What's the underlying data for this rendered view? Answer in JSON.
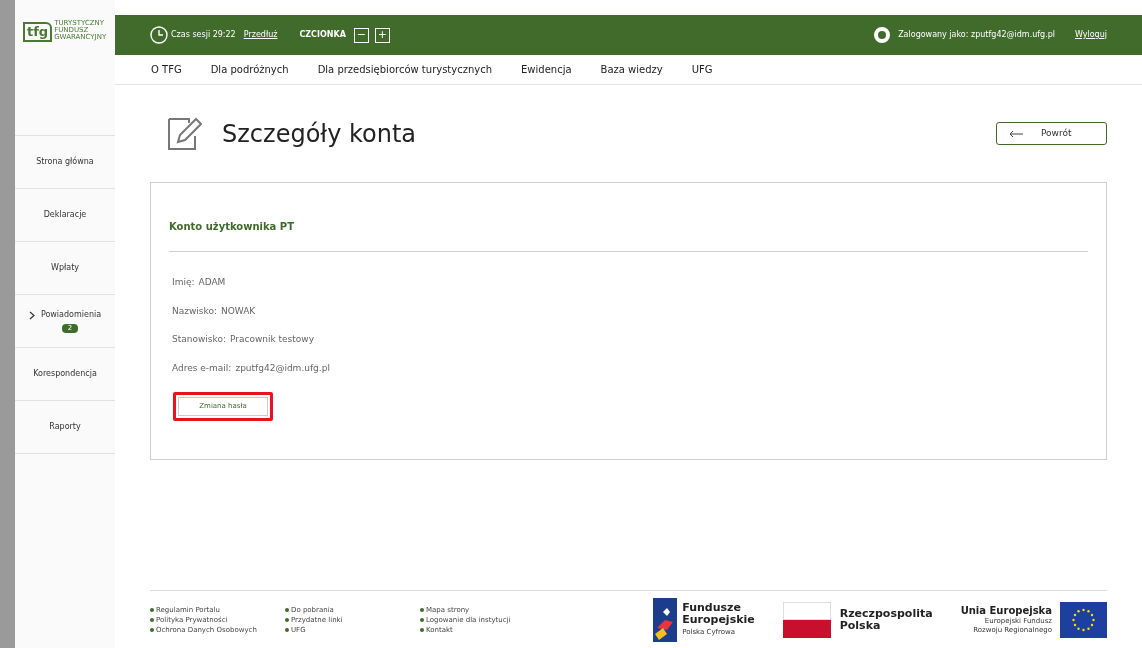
{
  "logo": {
    "mark": "tfg",
    "lines": [
      "TURYSTYCZNY",
      "FUNDUSZ",
      "GWARANCYJNY"
    ]
  },
  "header": {
    "session_label": "Czas sesji 29:22",
    "extend": "Przedłuż",
    "font_label": "CZCIONKA",
    "font_minus": "−",
    "font_plus": "+",
    "logged_as": "Zalogowany jako: zputfg42@idm.ufg.pl",
    "logout": "Wyloguj"
  },
  "nav": [
    "O TFG",
    "Dla podróżnych",
    "Dla przedsiębiorców turystycznych",
    "Ewidencja",
    "Baza wiedzy",
    "UFG"
  ],
  "sidebar": [
    {
      "label": "Strona główna",
      "expandable": false
    },
    {
      "label": "Deklaracje",
      "expandable": false
    },
    {
      "label": "Wpłaty",
      "expandable": false
    },
    {
      "label": "Powiadomienia",
      "expandable": true,
      "badge": "2"
    },
    {
      "label": "Korespondencja",
      "expandable": false
    },
    {
      "label": "Raporty",
      "expandable": false
    }
  ],
  "page": {
    "title": "Szczegóły konta",
    "back": "Powrót"
  },
  "card": {
    "heading": "Konto użytkownika PT",
    "fields": [
      {
        "label": "Imię:",
        "value": "ADAM"
      },
      {
        "label": "Nazwisko:",
        "value": "NOWAK"
      },
      {
        "label": "Stanowisko:",
        "value": "Pracownik testowy"
      },
      {
        "label": "Adres e-mail:",
        "value": "zputfg42@idm.ufg.pl"
      }
    ],
    "button": "Zmiana hasła",
    "button_highlighted": true
  },
  "footer": {
    "columns": [
      [
        "Regulamin Portalu",
        "Polityka Prywatności",
        "Ochrona Danych Osobowych"
      ],
      [
        "Do pobrania",
        "Przydatne linki",
        "UFG"
      ],
      [
        "Mapa strony",
        "Logowanie dla instytucji",
        "Kontakt"
      ]
    ],
    "fe": {
      "title": [
        "Fundusze",
        "Europejskie"
      ],
      "sub": "Polska Cyfrowa"
    },
    "rp": [
      "Rzeczpospolita",
      "Polska"
    ],
    "eu": {
      "title": "Unia Europejska",
      "sub": [
        "Europejski Fundusz",
        "Rozwoju Regionalnego"
      ]
    }
  }
}
